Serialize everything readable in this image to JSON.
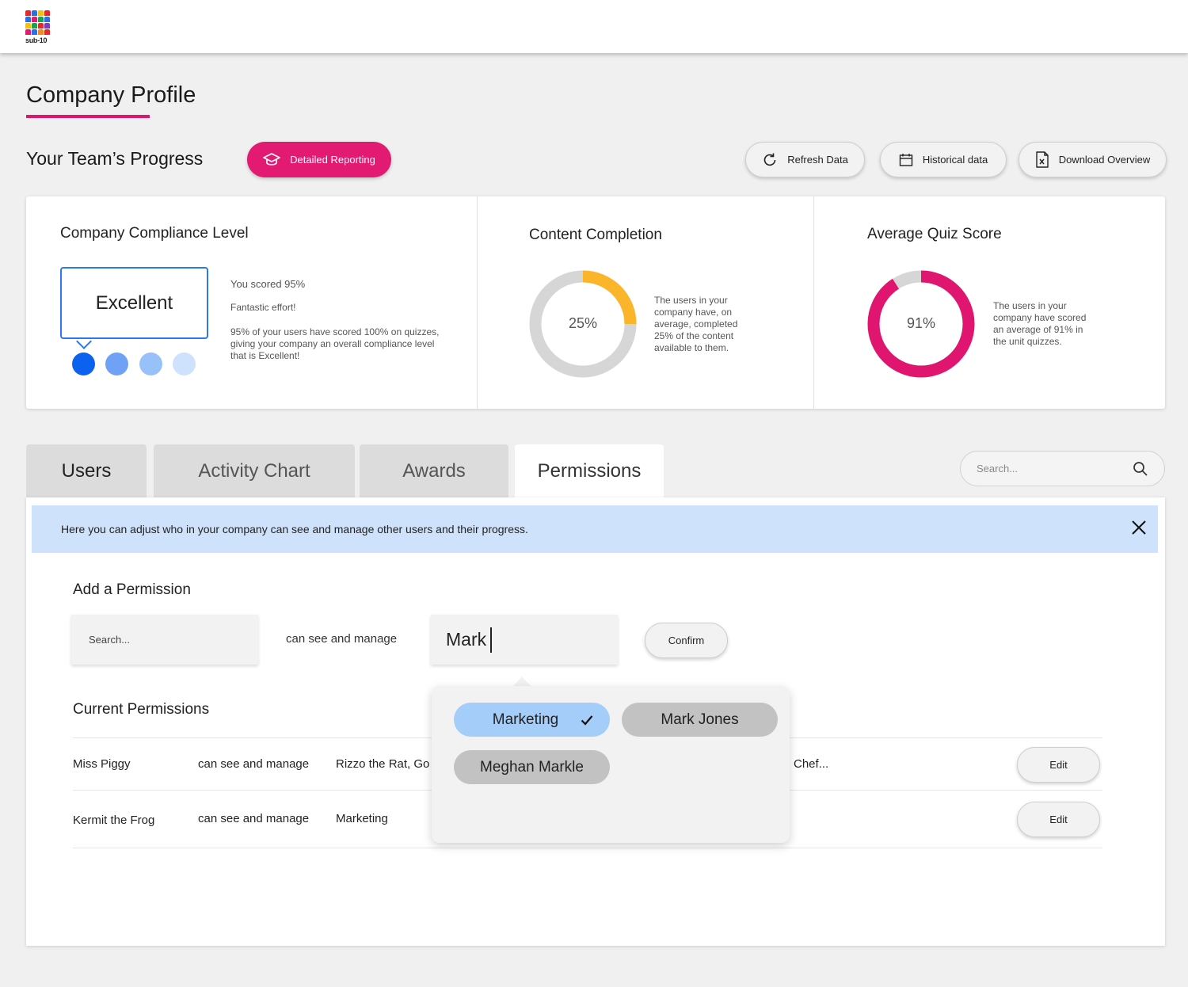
{
  "brand": {
    "logo_text": "sub-10"
  },
  "page": {
    "title": "Company Profile",
    "section_title": "Your Team’s Progress"
  },
  "toolbar": {
    "detailed_reporting": "Detailed Reporting",
    "refresh": "Refresh Data",
    "historical": "Historical data",
    "download": "Download Overview"
  },
  "compliance": {
    "title": "Company Compliance Level",
    "level": "Excellent",
    "score_text": "You scored 95%",
    "effort_text": "Fantastic effort!",
    "detail_line1": "95% of your users have scored 100% on quizzes,",
    "detail_line2": "giving your company an overall compliance level",
    "detail_line3": "that is Excellent!",
    "level_index": 1,
    "level_count": 4
  },
  "completion": {
    "title": "Content Completion",
    "value": 25,
    "value_label": "25%",
    "desc_line1": "The users in your",
    "desc_line2": "company have, on",
    "desc_line3": "average, completed",
    "desc_line4": "25% of the content",
    "desc_line5": "available to them."
  },
  "quiz": {
    "title": "Average Quiz Score",
    "value": 91,
    "value_label": "91%",
    "desc_line1": "The users in your",
    "desc_line2": "company have scored",
    "desc_line3": "an average of 91% in",
    "desc_line4": "the unit quizzes."
  },
  "tabs": {
    "users": "Users",
    "activity": "Activity Chart",
    "awards": "Awards",
    "permissions": "Permissions"
  },
  "search": {
    "placeholder": "Search..."
  },
  "permissions": {
    "info": "Here you can adjust who in your company can see and manage other users and their progress.",
    "add_title": "Add a Permission",
    "search_placeholder": "Search...",
    "relation": "can see and manage",
    "target_value": "Mark",
    "confirm": "Confirm",
    "current_title": "Current Permissions",
    "rows": [
      {
        "user": "Miss Piggy",
        "relation": "can see and manage",
        "targets": "Rizzo the Rat, Go",
        "targets_tail": "Chef...",
        "edit": "Edit"
      },
      {
        "user": "Kermit the Frog",
        "relation": "can see and manage",
        "targets": "Marketing",
        "edit": "Edit"
      }
    ],
    "suggestions": [
      {
        "label": "Marketing",
        "selected": true
      },
      {
        "label": "Mark Jones",
        "selected": false
      },
      {
        "label": "Meghan Markle",
        "selected": false
      }
    ]
  },
  "colors": {
    "brand_pink": "#e21a72",
    "accent_blue": "#2b78f0",
    "completion_orange": "#fbb52b",
    "quiz_pink": "#e0156f",
    "track_grey": "#d6d6d6",
    "chip_selected": "#a4cdfa",
    "chip_default": "#c2c2c2"
  }
}
